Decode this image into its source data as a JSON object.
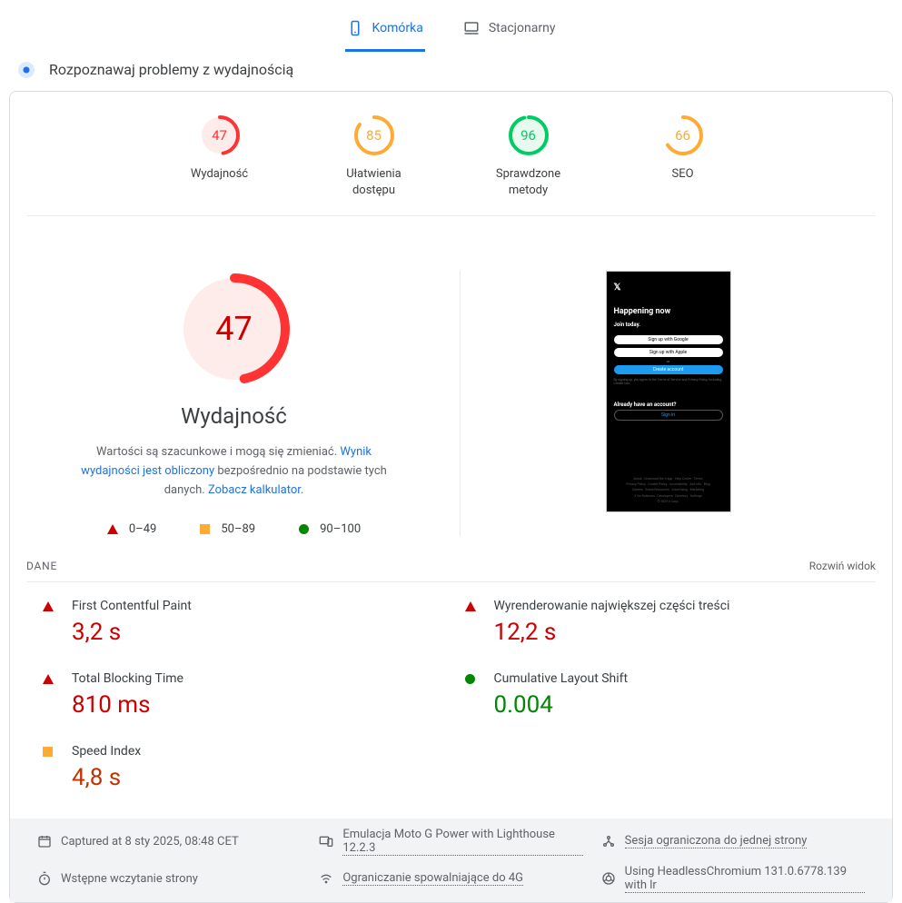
{
  "tabs": {
    "mobile": "Komórka",
    "desktop": "Stacjonarny"
  },
  "diagnose": "Rozpoznawaj problemy z wydajnością",
  "gauges": [
    {
      "score": "47",
      "label": "Wydajność",
      "color": "#f33",
      "bg": "#fdece9"
    },
    {
      "score": "85",
      "label": "Ułatwienia dostępu",
      "color": "#fa3",
      "bg": "#fff"
    },
    {
      "score": "96",
      "label": "Sprawdzone metody",
      "color": "#0c6",
      "bg": "#e8faef"
    },
    {
      "score": "66",
      "label": "SEO",
      "color": "#fa3",
      "bg": "#fff"
    }
  ],
  "performance": {
    "score": "47",
    "title": "Wydajność",
    "desc1": "Wartości są szacunkowe i mogą się zmieniać. ",
    "link1": "Wynik wydajności jest obliczony",
    "desc2": " bezpośrednio na podstawie tych danych. ",
    "link2": "Zobacz kalkulator",
    "desc3": "."
  },
  "legend": {
    "r": "0–49",
    "o": "50–89",
    "g": "90–100"
  },
  "screenshot": {
    "headline": "Happening now",
    "join": "Join today.",
    "google": "Sign up with Google",
    "apple": "Sign up with Apple",
    "or": "or",
    "create": "Create account",
    "already": "Already have an account?",
    "signin": "Sign in"
  },
  "dane": {
    "label": "DANE",
    "expand": "Rozwiń widok"
  },
  "metrics": [
    {
      "label": "First Contentful Paint",
      "value": "3,2 s",
      "status": "red"
    },
    {
      "label": "Wyrenderowanie największej części treści",
      "value": "12,2 s",
      "status": "red"
    },
    {
      "label": "Total Blocking Time",
      "value": "810 ms",
      "status": "red"
    },
    {
      "label": "Cumulative Layout Shift",
      "value": "0.004",
      "status": "green"
    },
    {
      "label": "Speed Index",
      "value": "4,8 s",
      "status": "orange"
    }
  ],
  "meta": {
    "captured": "Captured at 8 sty 2025, 08:48 CET",
    "emulation": "Emulacja Moto G Power with Lighthouse 12.2.3",
    "session": "Sesja ograniczona do jednej strony",
    "preload": "Wstępne wczytanie strony",
    "throttle": "Ograniczanie spowalniające do 4G",
    "browser": "Using HeadlessChromium 131.0.6778.139 with lr"
  }
}
